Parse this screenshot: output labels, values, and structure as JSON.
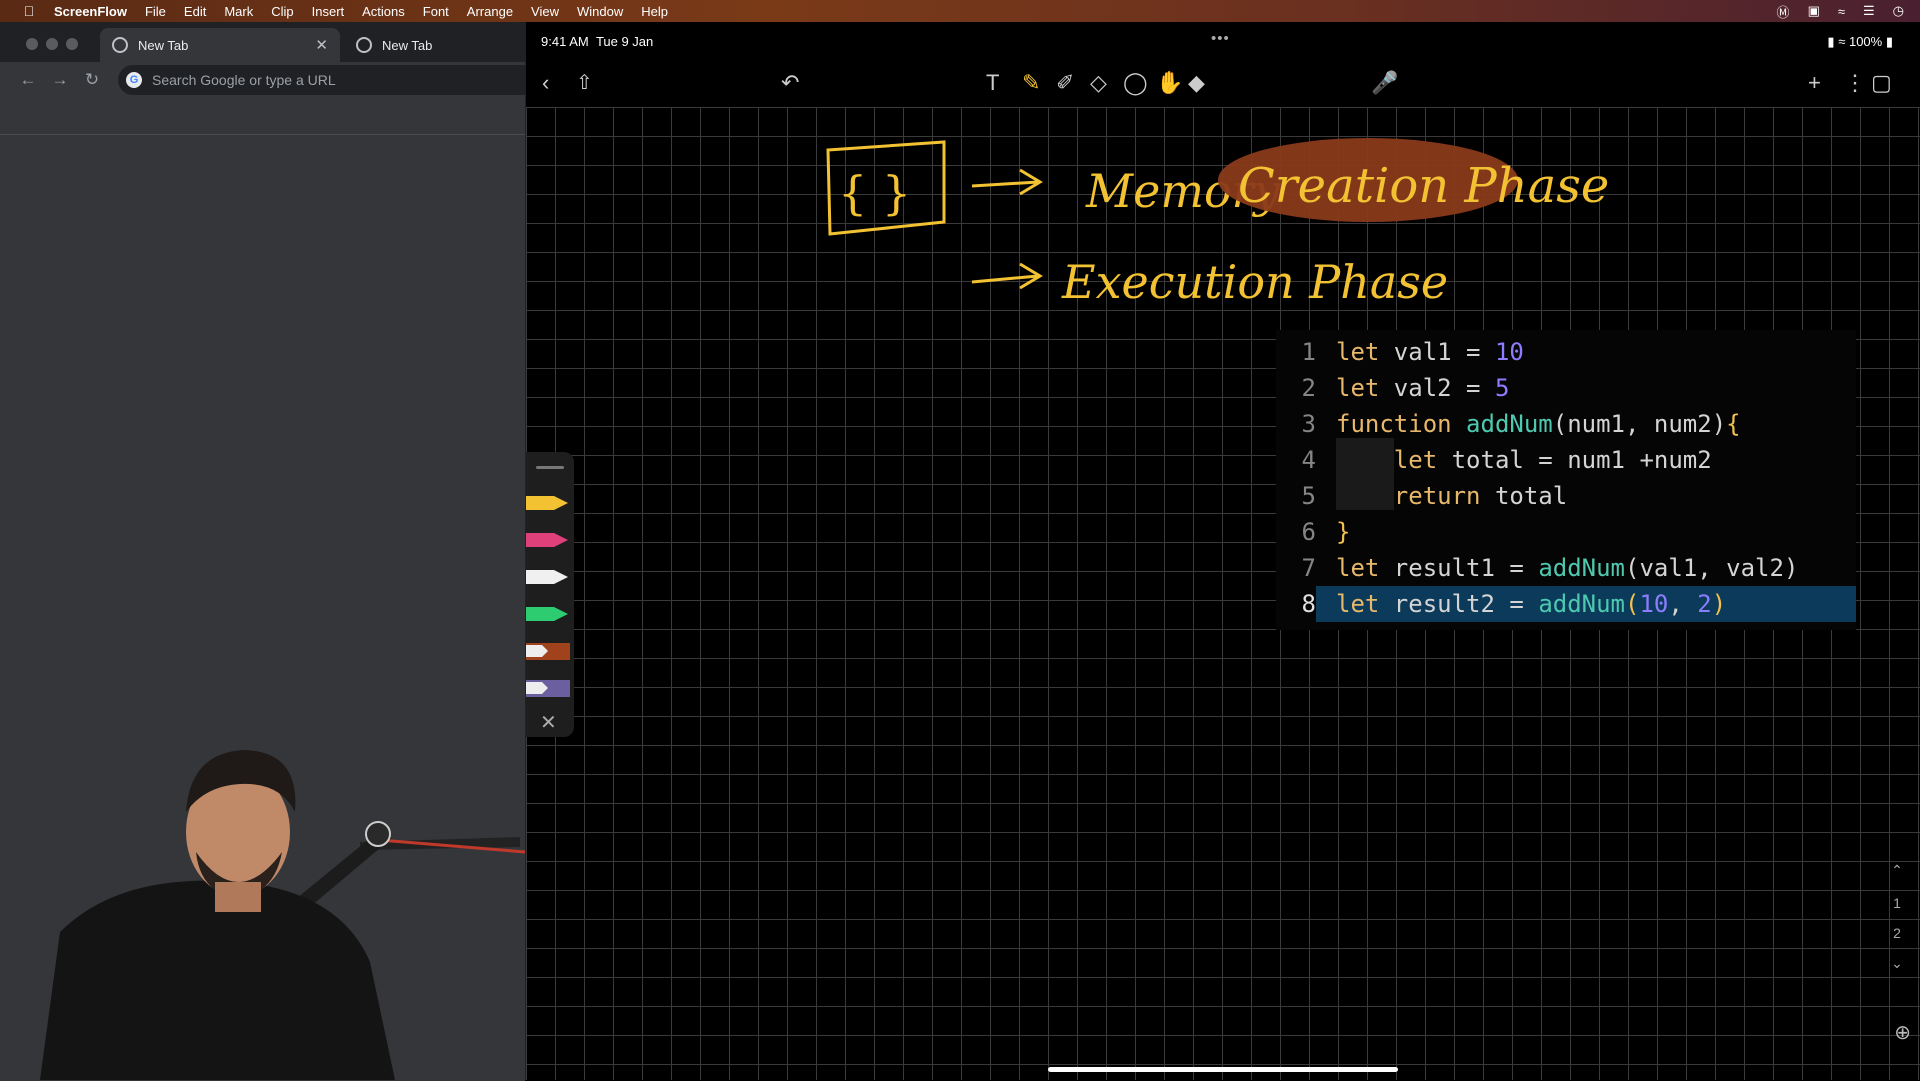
{
  "menubar": {
    "app_name": "ScreenFlow",
    "items": [
      "File",
      "Edit",
      "Mark",
      "Clip",
      "Insert",
      "Actions",
      "Font",
      "Arrange",
      "View",
      "Window",
      "Help"
    ]
  },
  "browser": {
    "tabs": [
      {
        "label": "New Tab"
      },
      {
        "label": "New Tab"
      }
    ],
    "omnibox_placeholder": "Search Google or type a URL"
  },
  "ipad": {
    "time": "9:41 AM",
    "date": "Tue 9 Jan",
    "battery": "100%",
    "toolbar_icons": [
      "back-icon",
      "share-icon",
      "undo-icon",
      "text-icon",
      "pen-icon",
      "highlighter-icon",
      "eraser-icon",
      "lasso-icon",
      "hand-icon",
      "shapes-icon",
      "microphone-icon",
      "add-icon",
      "more-icon",
      "pages-icon"
    ],
    "page_numbers": [
      "1",
      "2"
    ]
  },
  "handwriting": {
    "braces": "{ }",
    "memory": "Memory",
    "creation_phase": "Creation Phase",
    "execution_phase": "Execution Phase"
  },
  "code": {
    "lines": [
      {
        "n": "1"
      },
      {
        "n": "2"
      },
      {
        "n": "3"
      },
      {
        "n": "4"
      },
      {
        "n": "5"
      },
      {
        "n": "6"
      },
      {
        "n": "7"
      },
      {
        "n": "8"
      }
    ],
    "tokens": {
      "l1": [
        "let",
        " val1 = ",
        "10"
      ],
      "l2": [
        "let",
        " val2 = ",
        "5"
      ],
      "l3": [
        "function",
        " ",
        "addNum",
        "(num1, num2)",
        "{"
      ],
      "l4": [
        "    ",
        "let",
        " total = num1 +num2"
      ],
      "l5": [
        "    ",
        "return",
        " total"
      ],
      "l6": [
        "}"
      ],
      "l7": [
        "let",
        " result1 = ",
        "addNum",
        "(val1, val2)"
      ],
      "l8": [
        "let",
        " result2 = ",
        "addNum",
        "(",
        "10",
        ", ",
        "2",
        ")"
      ]
    },
    "selected_line": "8"
  },
  "colors": {
    "handwriting": "#f3c233",
    "highlight": "#8a3a1a",
    "selection": "#0b3a5a"
  }
}
